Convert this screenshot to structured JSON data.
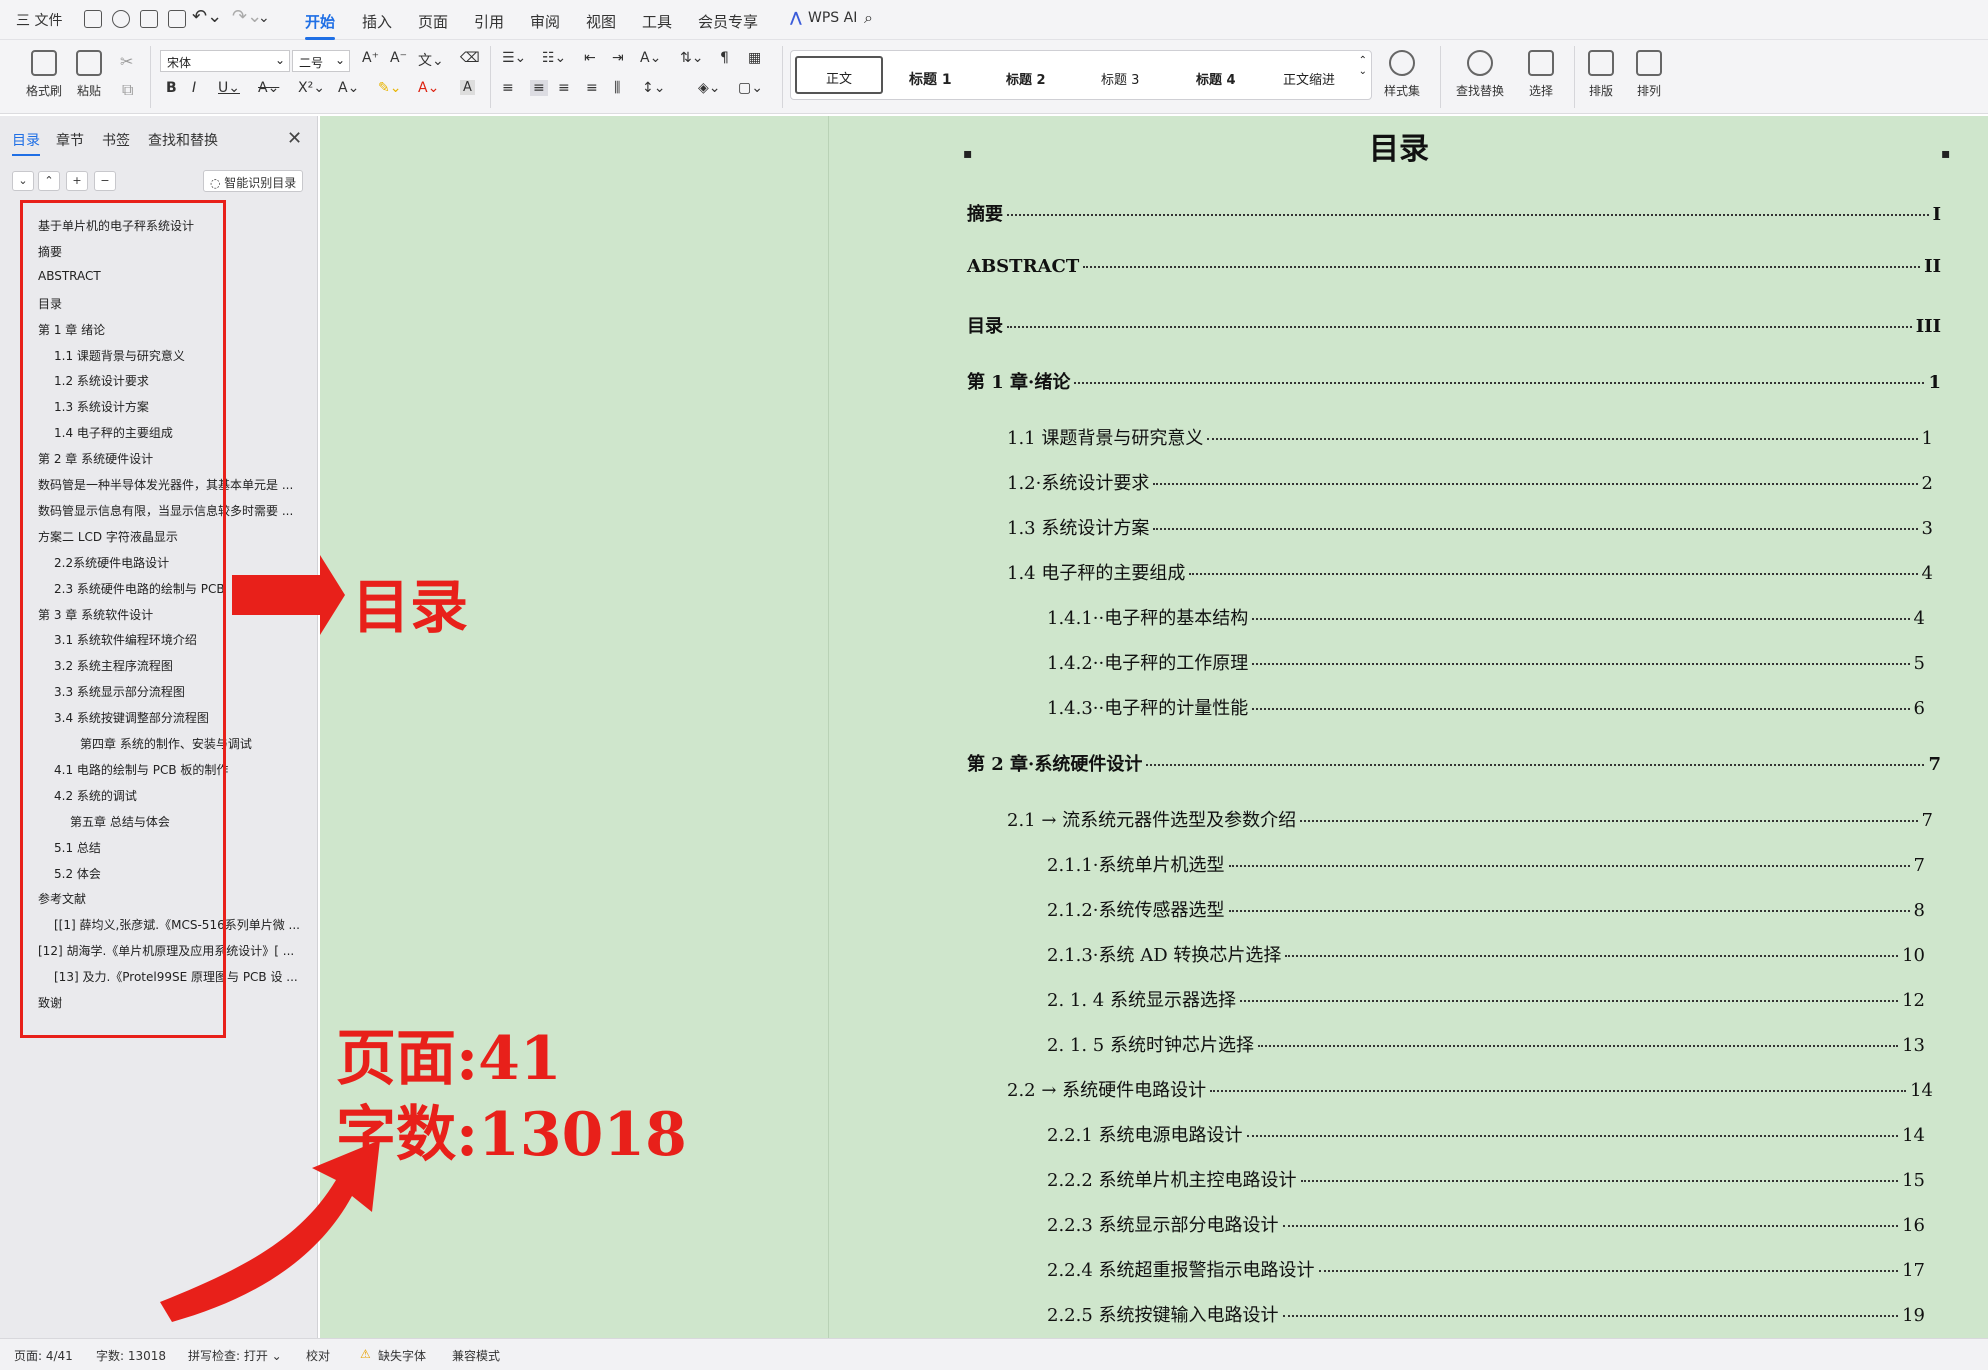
{
  "titlebar": {
    "menu_file": "三 文件",
    "tabs": [
      "开始",
      "插入",
      "页面",
      "引用",
      "审阅",
      "视图",
      "工具",
      "会员专享"
    ],
    "wps_ai": "WPS AI"
  },
  "ribbon": {
    "format_painter": "格式刷",
    "paste": "粘贴",
    "font_name": "宋体",
    "font_size": "二号",
    "styles": [
      "正文",
      "标题 1",
      "标题 2",
      "标题 3",
      "标题 4",
      "正文缩进"
    ],
    "style_set": "样式集",
    "find_replace": "查找替换",
    "select": "选择",
    "layout": "排版",
    "arrange": "排列"
  },
  "nav_panel": {
    "tabs": [
      "目录",
      "章节",
      "书签",
      "查找和替换"
    ],
    "smart_toc": "智能识别目录",
    "items": [
      {
        "label": "基于单片机的电子秤系统设计",
        "indent": 0,
        "arrow": ""
      },
      {
        "label": "摘要",
        "indent": 0,
        "arrow": ""
      },
      {
        "label": "ABSTRACT",
        "indent": 0,
        "arrow": ""
      },
      {
        "label": "目录",
        "indent": 0,
        "arrow": ""
      },
      {
        "label": "第 1 章  绪论",
        "indent": 0,
        "arrow": "▼"
      },
      {
        "label": "1.1 课题背景与研究意义",
        "indent": 1,
        "arrow": ""
      },
      {
        "label": "1.2  系统设计要求",
        "indent": 1,
        "arrow": "▶"
      },
      {
        "label": "1.3 系统设计方案",
        "indent": 1,
        "arrow": ""
      },
      {
        "label": "1.4 电子秤的主要组成",
        "indent": 1,
        "arrow": "▶"
      },
      {
        "label": "第 2 章  系统硬件设计",
        "indent": 0,
        "arrow": "▶"
      },
      {
        "label": "数码管是一种半导体发光器件，其基本单元是 ...",
        "indent": 0,
        "arrow": ""
      },
      {
        "label": "数码管显示信息有限，当显示信息较多时需要 ...",
        "indent": 0,
        "arrow": ""
      },
      {
        "label": "方案二  LCD 字符液晶显示",
        "indent": 0,
        "arrow": "▼"
      },
      {
        "label": "2.2系统硬件电路设计",
        "indent": 1,
        "arrow": "▶"
      },
      {
        "label": "2.3 系统硬件电路的绘制与 PCB",
        "indent": 1,
        "arrow": "▶"
      },
      {
        "label": "第 3 章  系统软件设计",
        "indent": 0,
        "arrow": "▼"
      },
      {
        "label": "3.1    系统软件编程环境介绍",
        "indent": 1,
        "arrow": ""
      },
      {
        "label": "3.2 系统主程序流程图",
        "indent": 1,
        "arrow": ""
      },
      {
        "label": "3.3 系统显示部分流程图",
        "indent": 1,
        "arrow": ""
      },
      {
        "label": "3.4 系统按键调整部分流程图",
        "indent": 1,
        "arrow": "▼"
      },
      {
        "label": "第四章    系统的制作、安装与调试",
        "indent": 3,
        "arrow": ""
      },
      {
        "label": "4.1 电路的绘制与 PCB 板的制作",
        "indent": 1,
        "arrow": "▶"
      },
      {
        "label": "4.2  系统的调试",
        "indent": 1,
        "arrow": "▼"
      },
      {
        "label": "第五章    总结与体会",
        "indent": 2,
        "arrow": ""
      },
      {
        "label": "5.1    总结",
        "indent": 1,
        "arrow": ""
      },
      {
        "label": "5.2    体会",
        "indent": 1,
        "arrow": ""
      },
      {
        "label": "参考文献",
        "indent": 0,
        "arrow": "▼"
      },
      {
        "label": "[[1]  薛均义,张彦斌.《MCS-516系列单片微 ...",
        "indent": 1,
        "arrow": ""
      },
      {
        "label": "[12]    胡海学.《单片机原理及应用系统设计》[ ...",
        "indent": 0,
        "arrow": "▼"
      },
      {
        "label": "[13]  及力.《Protel99SE 原理图与 PCB 设 ...",
        "indent": 1,
        "arrow": ""
      },
      {
        "label": "致谢",
        "indent": 0,
        "arrow": ""
      }
    ]
  },
  "annotations": {
    "toc_label": "目录",
    "pages_label": "页面:41",
    "words_label": "字数:13018"
  },
  "document": {
    "title": "目录",
    "entries": [
      {
        "label": "摘要",
        "page": "I",
        "level": 1
      },
      {
        "label": "ABSTRACT",
        "page": "II",
        "level": 1
      },
      {
        "label": "目录",
        "page": "III",
        "level": 1
      },
      {
        "label": "第 1 章·绪论",
        "page": "1",
        "level": 1
      },
      {
        "label": "1.1 课题背景与研究意义",
        "page": "1",
        "level": 2
      },
      {
        "label": "1.2·系统设计要求",
        "page": "2",
        "level": 2
      },
      {
        "label": "1.3 系统设计方案",
        "page": "3",
        "level": 2
      },
      {
        "label": "1.4 电子秤的主要组成",
        "page": "4",
        "level": 2
      },
      {
        "label": "1.4.1··电子秤的基本结构",
        "page": "4",
        "level": 3
      },
      {
        "label": "1.4.2··电子秤的工作原理",
        "page": "5",
        "level": 3
      },
      {
        "label": "1.4.3··电子秤的计量性能",
        "page": "6",
        "level": 3
      },
      {
        "label": "第 2 章·系统硬件设计",
        "page": "7",
        "level": 1
      },
      {
        "label": "2.1 →  流系统元器件选型及参数介绍",
        "page": "7",
        "level": 2
      },
      {
        "label": "2.1.1·系统单片机选型",
        "page": "7",
        "level": 3
      },
      {
        "label": "2.1.2·系统传感器选型",
        "page": "8",
        "level": 3
      },
      {
        "label": "2.1.3·系统 AD 转换芯片选择",
        "page": "10",
        "level": 3
      },
      {
        "label": "2. 1. 4 系统显示器选择",
        "page": "12",
        "level": 3
      },
      {
        "label": "2. 1. 5 系统时钟芯片选择",
        "page": "13",
        "level": 3
      },
      {
        "label": "2.2 →  系统硬件电路设计",
        "page": "14",
        "level": 2
      },
      {
        "label": "2.2.1 系统电源电路设计",
        "page": "14",
        "level": 3
      },
      {
        "label": "2.2.2 系统单片机主控电路设计",
        "page": "15",
        "level": 3
      },
      {
        "label": "2.2.3 系统显示部分电路设计",
        "page": "16",
        "level": 3
      },
      {
        "label": "2.2.4 系统超重报警指示电路设计",
        "page": "17",
        "level": 3
      },
      {
        "label": "2.2.5 系统按键输入电路设计",
        "page": "19",
        "level": 3
      }
    ]
  },
  "statusbar": {
    "page": "页面: 4/41",
    "words": "字数: 13018",
    "spell": "拼写检查: 打开",
    "proof": "校对",
    "missing_font": "缺失字体",
    "compat": "兼容模式"
  },
  "colors": {
    "accent": "#1f6fe5",
    "annotation_red": "#e8201a",
    "doc_bg": "#cfe6cc"
  }
}
